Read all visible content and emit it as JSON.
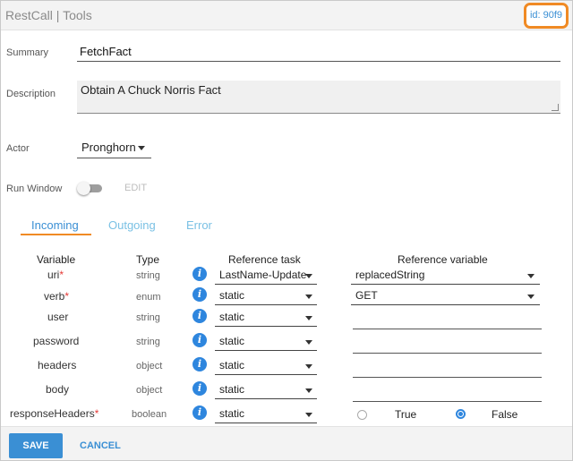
{
  "header": {
    "title": "RestCall | Tools",
    "id_badge": "id: 90f9"
  },
  "form": {
    "summary_label": "Summary",
    "summary_value": "FetchFact",
    "description_label": "Description",
    "description_value": "Obtain A Chuck Norris Fact",
    "actor_label": "Actor",
    "actor_value": "Pronghorn",
    "run_window_label": "Run Window",
    "run_window_on": false,
    "edit_label": "EDIT"
  },
  "tabs": [
    {
      "label": "Incoming",
      "active": true
    },
    {
      "label": "Outgoing",
      "active": false
    },
    {
      "label": "Error",
      "active": false
    }
  ],
  "table": {
    "headers": {
      "variable": "Variable",
      "type": "Type",
      "ref_task": "Reference task",
      "ref_var": "Reference variable"
    },
    "rows": [
      {
        "variable": "uri",
        "required": "*",
        "type": "string",
        "ref_task": "LastName-Update",
        "ref_var": "replacedString"
      },
      {
        "variable": "verb",
        "required": "*",
        "type": "enum",
        "ref_task": "static",
        "ref_var": "GET"
      },
      {
        "variable": "user",
        "required": "",
        "type": "string",
        "ref_task": "static",
        "ref_var": ""
      },
      {
        "variable": "password",
        "required": "",
        "type": "string",
        "ref_task": "static",
        "ref_var": ""
      },
      {
        "variable": "headers",
        "required": "",
        "type": "object",
        "ref_task": "static",
        "ref_var": ""
      },
      {
        "variable": "body",
        "required": "",
        "type": "object",
        "ref_task": "static",
        "ref_var": ""
      },
      {
        "variable": "responseHeaders",
        "required": "*",
        "type": "boolean",
        "ref_task": "static",
        "ref_var": ""
      }
    ],
    "boolean_options": {
      "true_label": "True",
      "false_label": "False",
      "selected": "False"
    },
    "info_glyph": "i"
  },
  "footer": {
    "save_label": "SAVE",
    "cancel_label": "CANCEL"
  },
  "colors": {
    "accent": "#3a8fd4",
    "highlight": "#f08a24",
    "required": "#e53935"
  }
}
